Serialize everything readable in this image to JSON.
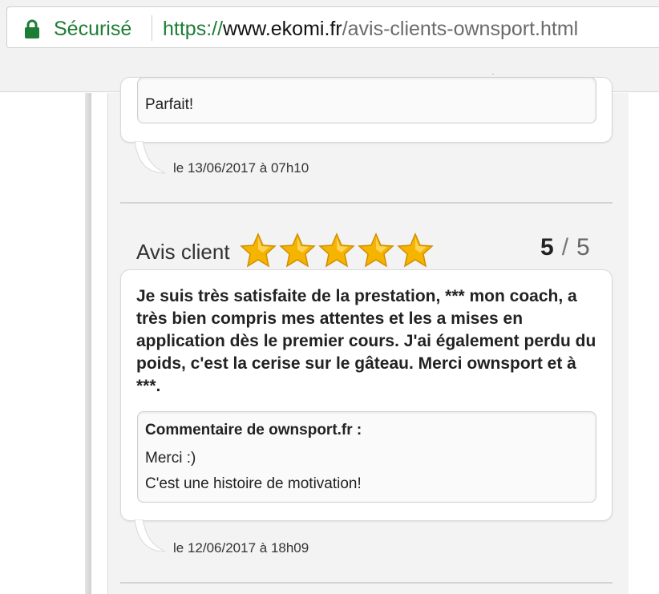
{
  "browser": {
    "secure_label": "Sécurisé",
    "url_scheme": "https://",
    "url_host": "www.ekomi.fr",
    "url_path": "/avis-clients-ownsport.html"
  },
  "previous_review": {
    "reply_text": "Parfait!",
    "date": "le 13/06/2017 à 07h10"
  },
  "review": {
    "title": "Avis client",
    "rating": 5,
    "rating_num": "5",
    "rating_slash": "/",
    "rating_max": "5",
    "body": "Je suis très satisfaite de la prestation, *** mon coach, a très bien compris mes attentes et les a mises en application dès le premier cours. J'ai également perdu du poids, c'est la cerise sur le gâteau. Merci ownsport et à ***.",
    "reply_title": "Commentaire de ownsport.fr :",
    "reply_line1": "Merci :)",
    "reply_line2": "C'est une histoire de motivation!",
    "date": "le 12/06/2017 à 18h09"
  },
  "colors": {
    "secure_green": "#1e7d34",
    "star_gold": "#f5b400"
  },
  "icons": {
    "lock": "lock-icon",
    "star": "star-icon"
  }
}
